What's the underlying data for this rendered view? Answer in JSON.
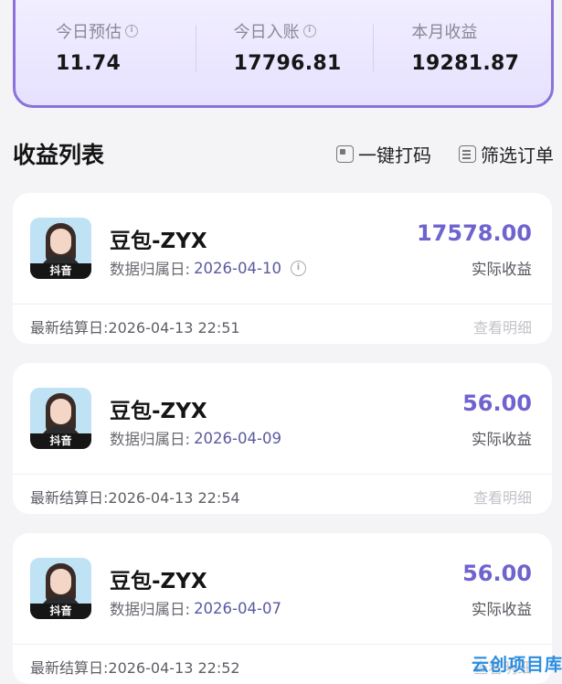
{
  "summary": {
    "stats": [
      {
        "label": "今日预估",
        "value": "11.74",
        "info": true
      },
      {
        "label": "今日入账",
        "value": "17796.81",
        "info": true
      },
      {
        "label": "本月收益",
        "value": "19281.87",
        "info": false
      }
    ]
  },
  "list": {
    "title": "收益列表",
    "actions": [
      {
        "label": "一键打码",
        "icon": "dice-icon"
      },
      {
        "label": "筛选订单",
        "icon": "filter-icon"
      }
    ]
  },
  "cards": [
    {
      "platform": "抖音",
      "name": "豆包-ZYX",
      "date_label": "数据归属日: ",
      "date": "2026-04-10",
      "amount": "17578.00",
      "amount_label": "实际收益",
      "settle": "最新结算日:2026-04-13 22:51",
      "detail": "查看明细"
    },
    {
      "platform": "抖音",
      "name": "豆包-ZYX",
      "date_label": "数据归属日: ",
      "date": "2026-04-09",
      "amount": "56.00",
      "amount_label": "实际收益",
      "settle": "最新结算日:2026-04-13 22:54",
      "detail": "查看明细"
    },
    {
      "platform": "抖音",
      "name": "豆包-ZYX",
      "date_label": "数据归属日: ",
      "date": "2026-04-07",
      "amount": "56.00",
      "amount_label": "实际收益",
      "settle": "最新结算日:2026-04-13 22:52",
      "detail": "查看明细"
    }
  ],
  "watermark": "云创项目库",
  "colors": {
    "accent": "#6f63cf",
    "border": "#8a72dc",
    "watermark": "#2a8de0"
  }
}
